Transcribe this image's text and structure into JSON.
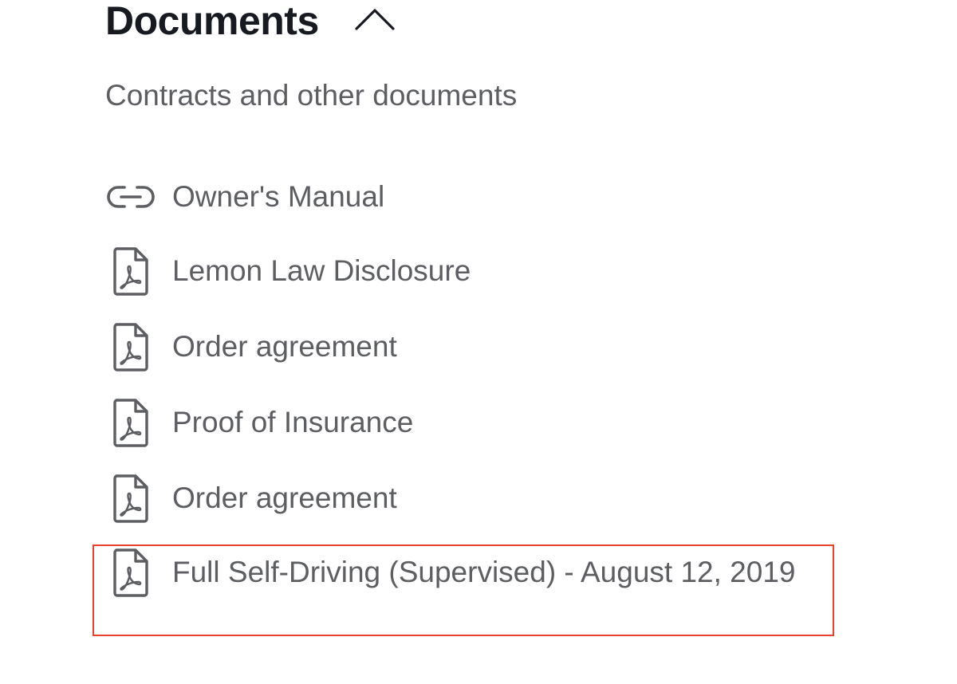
{
  "section": {
    "title": "Documents",
    "subtitle": "Contracts and other documents",
    "toggle_icon": "chevron-up-icon"
  },
  "documents": [
    {
      "label": "Owner's Manual",
      "icon": "link-icon"
    },
    {
      "label": "Lemon Law Disclosure",
      "icon": "pdf-icon"
    },
    {
      "label": "Order agreement",
      "icon": "pdf-icon"
    },
    {
      "label": "Proof of Insurance",
      "icon": "pdf-icon"
    },
    {
      "label": "Order agreement",
      "icon": "pdf-icon"
    },
    {
      "label": "Full Self-Driving (Supervised) - August 12, 2019",
      "icon": "pdf-icon"
    }
  ],
  "colors": {
    "title": "#171a20",
    "text": "#5c5e62",
    "icon": "#5c5e62",
    "highlight": "#e8412f"
  }
}
